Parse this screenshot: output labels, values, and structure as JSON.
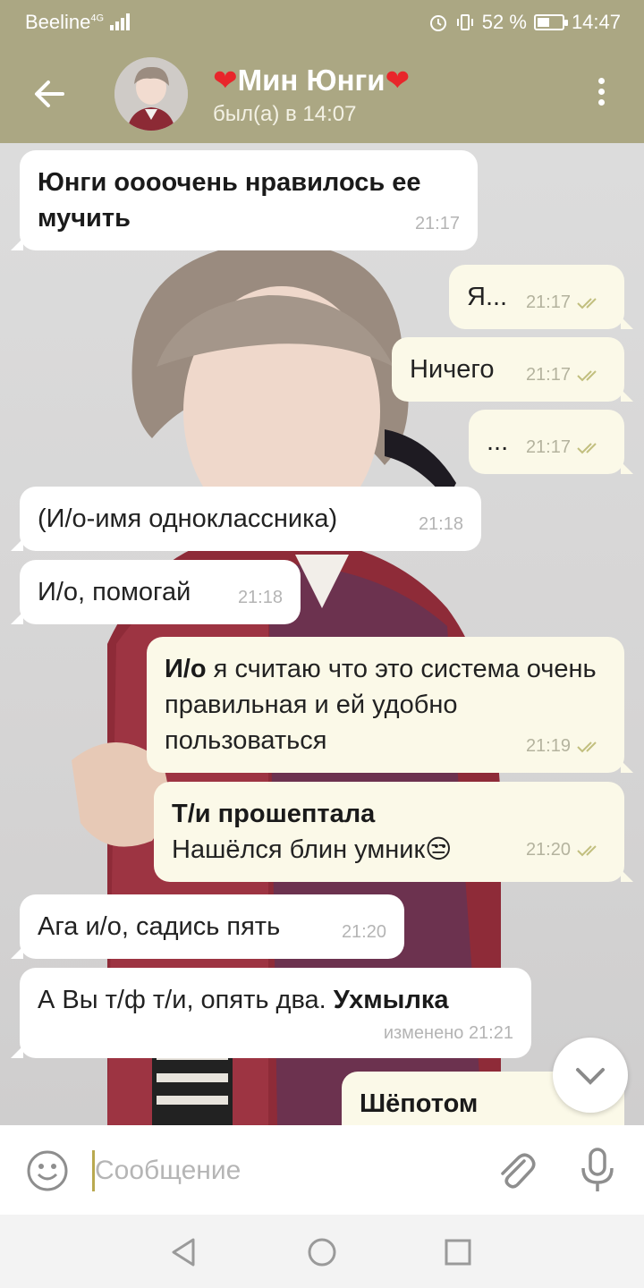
{
  "status_bar": {
    "carrier": "Beeline",
    "network": "4G",
    "battery_percent": "52 %",
    "battery_level": 0.52,
    "time": "14:47"
  },
  "header": {
    "heart_left": "❤",
    "name": "Мин Юнги",
    "heart_right": "❤",
    "last_seen": "был(а) в 14:07",
    "accent_color": "#aba783"
  },
  "messages": [
    {
      "dir": "in",
      "text": "Юнги оооочень нравилось ее мучить",
      "time": "21:17"
    },
    {
      "dir": "out",
      "text": "Я...",
      "time": "21:17"
    },
    {
      "dir": "out",
      "text": "Ничего",
      "time": "21:17"
    },
    {
      "dir": "out",
      "text": "...",
      "time": "21:17"
    },
    {
      "dir": "in",
      "text": "(И/о-имя одноклассника)",
      "time": "21:18"
    },
    {
      "dir": "in",
      "text": "И/о, помогай",
      "time": "21:18"
    },
    {
      "dir": "out",
      "bold": "И/о",
      "text": " я считаю что это система очень правильная и ей удобно пользоваться",
      "time": "21:19"
    },
    {
      "dir": "out",
      "bold": "Т/и прошептала",
      "text": "Нашёлся блин умник😒",
      "time": "21:20"
    },
    {
      "dir": "in",
      "text": "Ага и/о, садись пять",
      "time": "21:20"
    },
    {
      "dir": "in",
      "text": "А Вы т/ф т/и, опять два. ",
      "bold_after": "Ухмылка",
      "edited": "изменено",
      "time": "21:21"
    },
    {
      "dir": "out",
      "bold": "Шёпотом",
      "text": ""
    }
  ],
  "input": {
    "placeholder": "Сообщение"
  },
  "icons": {
    "back": "arrow-left-icon",
    "menu": "more-vertical-icon",
    "emoji": "smiley-icon",
    "attach": "paperclip-icon",
    "mic": "microphone-icon",
    "scroll": "chevron-down-icon",
    "nav_back": "triangle-back-icon",
    "nav_home": "circle-home-icon",
    "nav_recent": "square-recent-icon"
  }
}
